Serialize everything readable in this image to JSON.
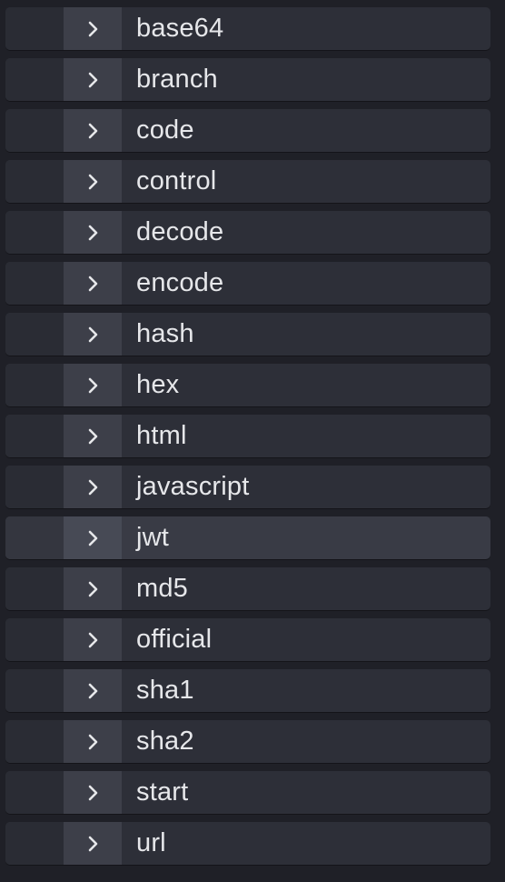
{
  "accent": "#e6e7ea",
  "chevron_icon": "chevron-right-icon",
  "items": [
    {
      "label": "base64"
    },
    {
      "label": "branch"
    },
    {
      "label": "code"
    },
    {
      "label": "control"
    },
    {
      "label": "decode"
    },
    {
      "label": "encode"
    },
    {
      "label": "hash"
    },
    {
      "label": "hex"
    },
    {
      "label": "html"
    },
    {
      "label": "javascript"
    },
    {
      "label": "jwt"
    },
    {
      "label": "md5"
    },
    {
      "label": "official"
    },
    {
      "label": "sha1"
    },
    {
      "label": "sha2"
    },
    {
      "label": "start"
    },
    {
      "label": "url"
    }
  ],
  "highlighted": "jwt"
}
